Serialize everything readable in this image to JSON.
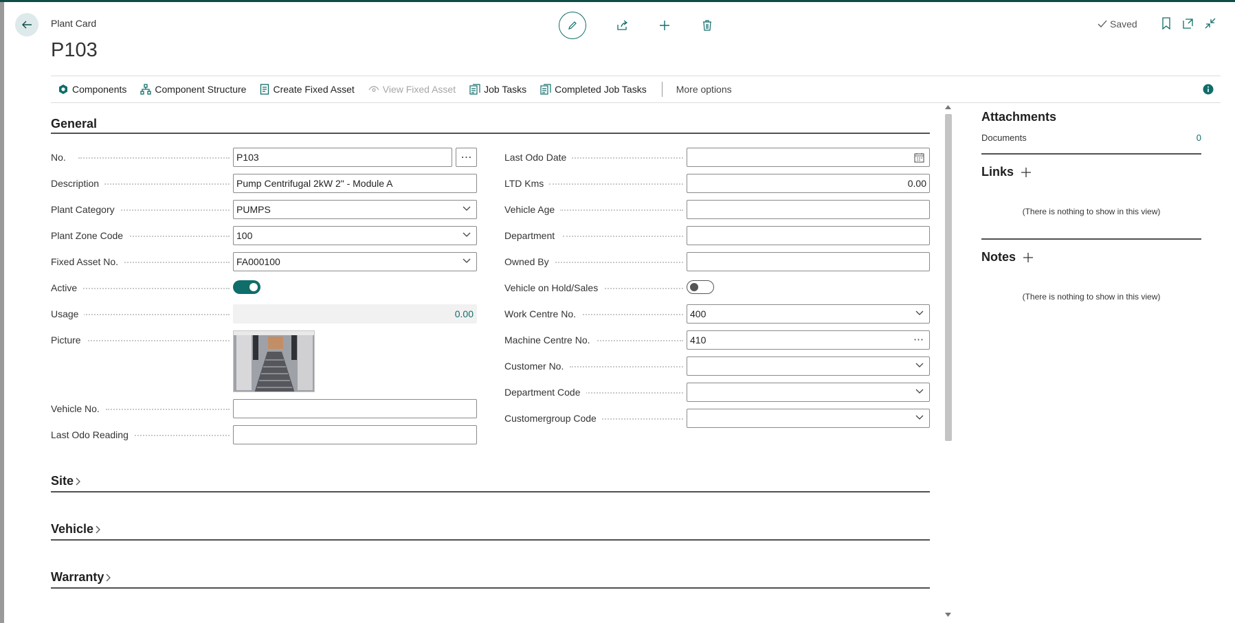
{
  "header": {
    "caption": "Plant Card",
    "title": "P103",
    "saved_status": "Saved"
  },
  "actions": [
    {
      "label": "Components",
      "icon": "component-icon",
      "disabled": false
    },
    {
      "label": "Component Structure",
      "icon": "structure-icon",
      "disabled": false
    },
    {
      "label": "Create Fixed Asset",
      "icon": "document-icon",
      "disabled": false
    },
    {
      "label": "View Fixed Asset",
      "icon": "view-icon",
      "disabled": true
    },
    {
      "label": "Job Tasks",
      "icon": "tasks-icon",
      "disabled": false
    },
    {
      "label": "Completed Job Tasks",
      "icon": "tasks-icon",
      "disabled": false
    }
  ],
  "more_options": "More options",
  "general": {
    "title": "General",
    "left_fields": [
      {
        "label": "No.",
        "value": "P103",
        "type": "text-ellipsis"
      },
      {
        "label": "Description",
        "value": "Pump Centrifugal 2kW 2\" - Module A",
        "type": "text"
      },
      {
        "label": "Plant Category",
        "value": "PUMPS",
        "type": "select"
      },
      {
        "label": "Plant Zone Code",
        "value": "100",
        "type": "select"
      },
      {
        "label": "Fixed Asset No.",
        "value": "FA000100",
        "type": "select"
      },
      {
        "label": "Active",
        "value": true,
        "type": "toggle"
      },
      {
        "label": "Usage",
        "value": "0.00",
        "type": "readonly"
      },
      {
        "label": "Picture",
        "type": "picture"
      },
      {
        "label": "Vehicle No.",
        "value": "",
        "type": "text"
      },
      {
        "label": "Last Odo Reading",
        "value": "",
        "type": "text"
      }
    ],
    "right_fields": [
      {
        "label": "Last Odo Date",
        "value": "",
        "type": "date"
      },
      {
        "label": "LTD Kms",
        "value": "0.00",
        "type": "number"
      },
      {
        "label": "Vehicle Age",
        "value": "",
        "type": "text"
      },
      {
        "label": "Department",
        "value": "",
        "type": "text"
      },
      {
        "label": "Owned By",
        "value": "",
        "type": "text"
      },
      {
        "label": "Vehicle on Hold/Sales",
        "value": false,
        "type": "toggle"
      },
      {
        "label": "Work Centre No.",
        "value": "400",
        "type": "select"
      },
      {
        "label": "Machine Centre No.",
        "value": "410",
        "type": "text-inner-ellipsis"
      },
      {
        "label": "Customer No.",
        "value": "",
        "type": "select"
      },
      {
        "label": "Department Code",
        "value": "",
        "type": "select"
      },
      {
        "label": "Customergroup Code",
        "value": "",
        "type": "select"
      }
    ]
  },
  "collapsed_sections": [
    "Site",
    "Vehicle",
    "Warranty"
  ],
  "factbox": {
    "attachments_title": "Attachments",
    "documents_label": "Documents",
    "documents_count": "0",
    "links_title": "Links",
    "links_empty": "(There is nothing to show in this view)",
    "notes_title": "Notes",
    "notes_empty": "(There is nothing to show in this view)"
  },
  "colors": {
    "accent": "#0f6d6a",
    "top_bar": "#0f4d47"
  }
}
